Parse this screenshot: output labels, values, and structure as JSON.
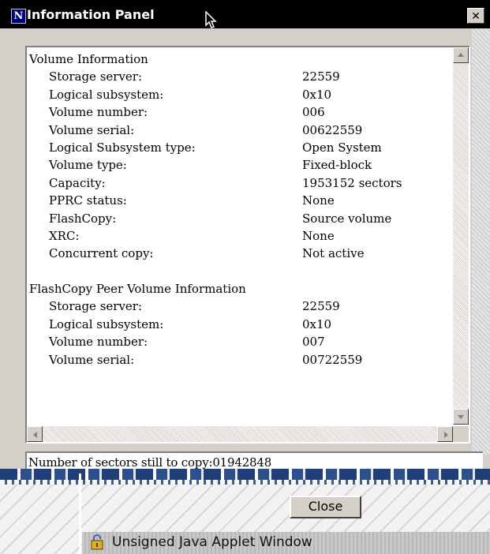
{
  "window": {
    "title": "Information Panel",
    "app_icon_glyph": "N",
    "close_glyph": "✕"
  },
  "panel": {
    "sections": [
      {
        "heading": "Volume Information",
        "rows": [
          {
            "label": "Storage server:",
            "value": "22559"
          },
          {
            "label": "Logical subsystem:",
            "value": "0x10"
          },
          {
            "label": "Volume number:",
            "value": "006"
          },
          {
            "label": "Volume serial:",
            "value": "00622559"
          },
          {
            "label": "Logical Subsystem type:",
            "value": "Open System"
          },
          {
            "label": "Volume type:",
            "value": "Fixed-block"
          },
          {
            "label": "Capacity:",
            "value": "1953152 sectors"
          },
          {
            "label": "PPRC status:",
            "value": "None"
          },
          {
            "label": "FlashCopy:",
            "value": "Source volume"
          },
          {
            "label": "XRC:",
            "value": "None"
          },
          {
            "label": "Concurrent copy:",
            "value": "Not active"
          }
        ]
      },
      {
        "heading": "FlashCopy Peer Volume Information",
        "rows": [
          {
            "label": "Storage server:",
            "value": "22559"
          },
          {
            "label": "Logical subsystem:",
            "value": "0x10"
          },
          {
            "label": "Volume number:",
            "value": "007"
          },
          {
            "label": "Volume serial:",
            "value": "00722559"
          }
        ]
      }
    ]
  },
  "status": {
    "text": "Number of sectors still to copy:01942848"
  },
  "buttons": {
    "close_label": "Close"
  },
  "applet": {
    "label": "Unsigned Java Applet Window"
  },
  "icons": {
    "app": "netscape-icon",
    "cursor": "mouse-pointer-icon",
    "close": "close-icon",
    "applet": "lock-icon"
  },
  "colors": {
    "titlebar": "#000000",
    "face": "#d4d0c8",
    "panel_bg": "#ffffff"
  }
}
